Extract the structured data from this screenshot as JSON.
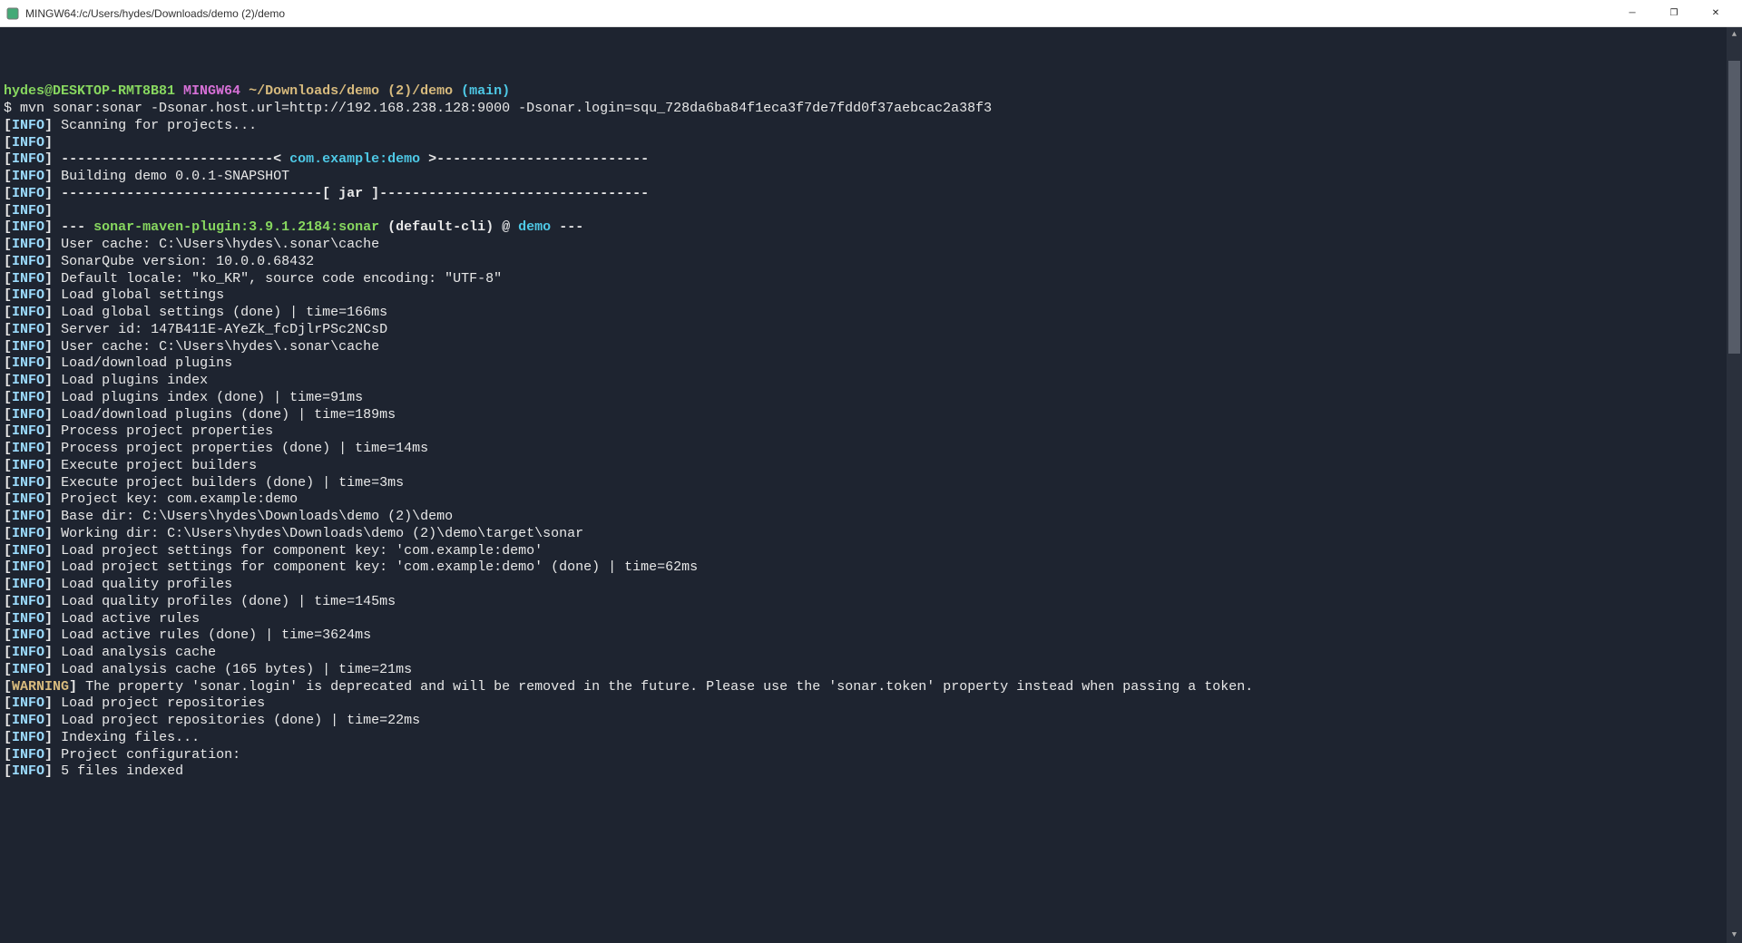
{
  "window_title": "MINGW64:/c/Users/hydes/Downloads/demo (2)/demo",
  "prompt": {
    "user_host": "hydes@DESKTOP-RMT8B81",
    "shell": "MINGW64",
    "cwd": "~/Downloads/demo (2)/demo",
    "branch": "(main)",
    "symbol": "$"
  },
  "command": "mvn sonar:sonar -Dsonar.host.url=http://192.168.238.128:9000 -Dsonar.login=squ_728da6ba84f1eca3f7de7fdd0f37aebcac2a38f3",
  "lines": [
    {
      "lvl": "INFO",
      "txt": "Scanning for projects..."
    },
    {
      "lvl": "INFO",
      "txt": ""
    },
    {
      "lvl": "INFO",
      "type": "divider_open",
      "artifact": "com.example:demo"
    },
    {
      "lvl": "INFO",
      "txt": "Building demo 0.0.1-SNAPSHOT"
    },
    {
      "lvl": "INFO",
      "type": "divider_jar"
    },
    {
      "lvl": "INFO",
      "txt": ""
    },
    {
      "lvl": "INFO",
      "type": "plugin",
      "plugin": "sonar-maven-plugin:3.9.1.2184:sonar",
      "goal": "(default-cli) @",
      "artifact": "demo"
    },
    {
      "lvl": "INFO",
      "txt": "User cache: C:\\Users\\hydes\\.sonar\\cache"
    },
    {
      "lvl": "INFO",
      "txt": "SonarQube version: 10.0.0.68432"
    },
    {
      "lvl": "INFO",
      "txt": "Default locale: \"ko_KR\", source code encoding: \"UTF-8\""
    },
    {
      "lvl": "INFO",
      "txt": "Load global settings"
    },
    {
      "lvl": "INFO",
      "txt": "Load global settings (done) | time=166ms"
    },
    {
      "lvl": "INFO",
      "txt": "Server id: 147B411E-AYeZk_fcDjlrPSc2NCsD"
    },
    {
      "lvl": "INFO",
      "txt": "User cache: C:\\Users\\hydes\\.sonar\\cache"
    },
    {
      "lvl": "INFO",
      "txt": "Load/download plugins"
    },
    {
      "lvl": "INFO",
      "txt": "Load plugins index"
    },
    {
      "lvl": "INFO",
      "txt": "Load plugins index (done) | time=91ms"
    },
    {
      "lvl": "INFO",
      "txt": "Load/download plugins (done) | time=189ms"
    },
    {
      "lvl": "INFO",
      "txt": "Process project properties"
    },
    {
      "lvl": "INFO",
      "txt": "Process project properties (done) | time=14ms"
    },
    {
      "lvl": "INFO",
      "txt": "Execute project builders"
    },
    {
      "lvl": "INFO",
      "txt": "Execute project builders (done) | time=3ms"
    },
    {
      "lvl": "INFO",
      "txt": "Project key: com.example:demo"
    },
    {
      "lvl": "INFO",
      "txt": "Base dir: C:\\Users\\hydes\\Downloads\\demo (2)\\demo"
    },
    {
      "lvl": "INFO",
      "txt": "Working dir: C:\\Users\\hydes\\Downloads\\demo (2)\\demo\\target\\sonar"
    },
    {
      "lvl": "INFO",
      "txt": "Load project settings for component key: 'com.example:demo'"
    },
    {
      "lvl": "INFO",
      "txt": "Load project settings for component key: 'com.example:demo' (done) | time=62ms"
    },
    {
      "lvl": "INFO",
      "txt": "Load quality profiles"
    },
    {
      "lvl": "INFO",
      "txt": "Load quality profiles (done) | time=145ms"
    },
    {
      "lvl": "INFO",
      "txt": "Load active rules"
    },
    {
      "lvl": "INFO",
      "txt": "Load active rules (done) | time=3624ms"
    },
    {
      "lvl": "INFO",
      "txt": "Load analysis cache"
    },
    {
      "lvl": "INFO",
      "txt": "Load analysis cache (165 bytes) | time=21ms"
    },
    {
      "lvl": "WARNING",
      "txt": "The property 'sonar.login' is deprecated and will be removed in the future. Please use the 'sonar.token' property instead when passing a token."
    },
    {
      "lvl": "INFO",
      "txt": "Load project repositories"
    },
    {
      "lvl": "INFO",
      "txt": "Load project repositories (done) | time=22ms"
    },
    {
      "lvl": "INFO",
      "txt": "Indexing files..."
    },
    {
      "lvl": "INFO",
      "txt": "Project configuration:"
    },
    {
      "lvl": "INFO",
      "txt": "5 files indexed"
    }
  ],
  "scrollbar": {
    "thumb_top_pct": 2,
    "thumb_height_pct": 32
  }
}
